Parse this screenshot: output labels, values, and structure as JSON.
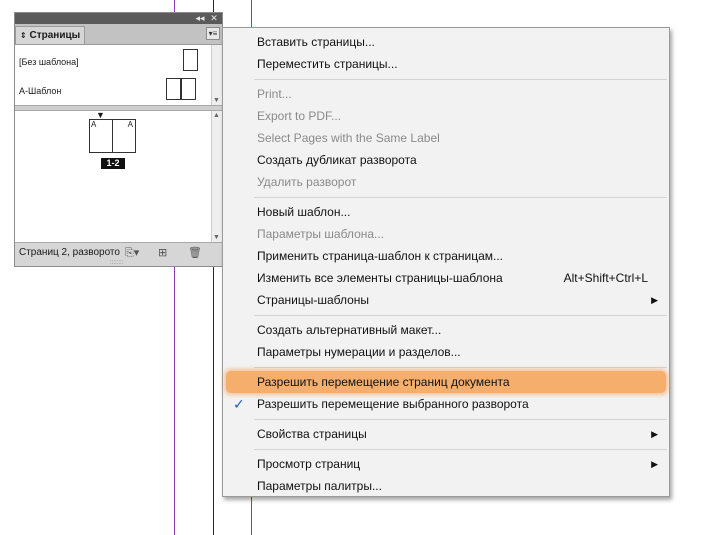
{
  "panel": {
    "title": "Страницы",
    "tab_icon": "double-arrow-icon",
    "masters": [
      {
        "label": "[Без шаблона]"
      },
      {
        "label": "А-Шаблон"
      }
    ],
    "spread": {
      "left_prefix": "A",
      "right_prefix": "A",
      "label": "1-2"
    },
    "status": "Страниц 2, разворото"
  },
  "menu": {
    "items": [
      {
        "label": "Вставить страницы...",
        "disabled": false
      },
      {
        "label": "Переместить страницы...",
        "disabled": false
      },
      {
        "label": "Print...",
        "disabled": true
      },
      {
        "label": "Export to PDF...",
        "disabled": true
      },
      {
        "label": "Select Pages with the Same Label",
        "disabled": true
      },
      {
        "label": "Создать дубликат разворота",
        "disabled": false
      },
      {
        "label": "Удалить разворот",
        "disabled": true
      },
      {
        "label": "Новый шаблон...",
        "disabled": false
      },
      {
        "label": "Параметры шаблона...",
        "disabled": true
      },
      {
        "label": "Применить страница-шаблон к страницам...",
        "disabled": false
      },
      {
        "label": "Изменить все элементы страницы-шаблона",
        "shortcut": "Alt+Shift+Ctrl+L",
        "disabled": false
      },
      {
        "label": "Страницы-шаблоны",
        "submenu": true,
        "disabled": false
      },
      {
        "label": "Создать альтернативный макет...",
        "disabled": false
      },
      {
        "label": "Параметры нумерации и разделов...",
        "disabled": false
      },
      {
        "label": "Разрешить перемещение страниц документа",
        "highlighted": true,
        "disabled": false
      },
      {
        "label": "Разрешить перемещение выбранного разворота",
        "checked": true,
        "disabled": false
      },
      {
        "label": "Свойства страницы",
        "submenu": true,
        "disabled": false
      },
      {
        "label": "Просмотр страниц",
        "submenu": true,
        "disabled": false
      },
      {
        "label": "Параметры палитры...",
        "disabled": false
      }
    ]
  },
  "colors": {
    "highlight": "#f5ae6c",
    "guide": "#8e3bb5",
    "check": "#1c5fb5"
  }
}
